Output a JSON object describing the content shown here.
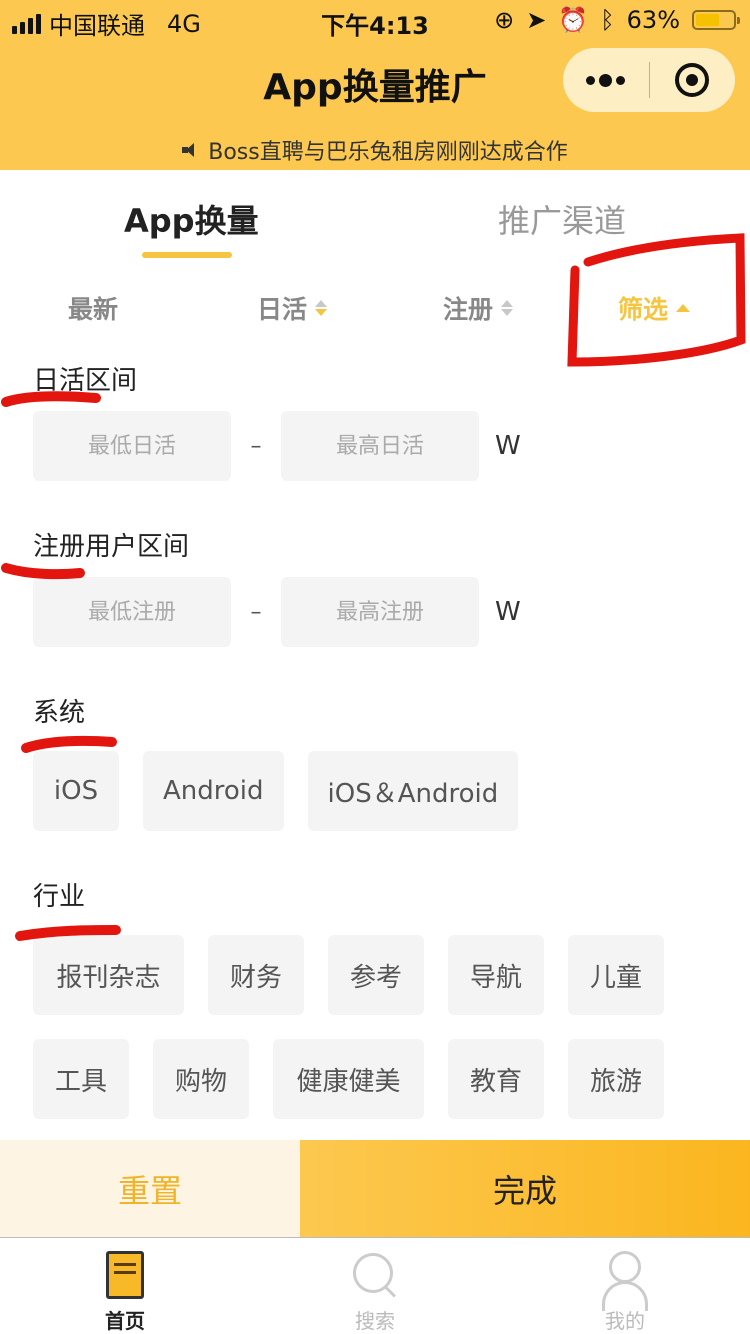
{
  "status_bar": {
    "carrier": "中国联通",
    "network": "4G",
    "time": "下午4:13",
    "battery": "63%",
    "battery_level": 0.63,
    "icons": [
      "rotation-lock-icon",
      "location-icon",
      "alarm-icon",
      "bluetooth-icon"
    ]
  },
  "header": {
    "title": "App换量推广",
    "notice": "Boss直聘与巴乐兔租房刚刚达成合作",
    "capsule": {
      "more_icon": "more-dots-icon",
      "close_icon": "target-icon"
    },
    "accent": "#fcc84f"
  },
  "tabs": [
    {
      "label": "App换量",
      "active": true
    },
    {
      "label": "推广渠道",
      "active": false
    }
  ],
  "sort_bar": {
    "items": [
      {
        "label": "最新"
      },
      {
        "label": "日活",
        "sort": "desc"
      },
      {
        "label": "注册",
        "sort": "none"
      },
      {
        "label": "筛选",
        "active": true
      }
    ]
  },
  "filters": {
    "daily_active": {
      "title": "日活区间",
      "min_placeholder": "最低日活",
      "max_placeholder": "最高日活",
      "min_value": "",
      "max_value": "",
      "separator": "–",
      "unit": "W"
    },
    "registered": {
      "title": "注册用户区间",
      "min_placeholder": "最低注册",
      "max_placeholder": "最高注册",
      "min_value": "",
      "max_value": "",
      "separator": "–",
      "unit": "W"
    },
    "system": {
      "title": "系统",
      "options": [
        "iOS",
        "Android",
        "iOS＆Android"
      ]
    },
    "industry": {
      "title": "行业",
      "options": [
        "报刊杂志",
        "财务",
        "参考",
        "导航",
        "儿童",
        "工具",
        "购物",
        "健康健美",
        "教育",
        "旅游"
      ]
    }
  },
  "actions": {
    "reset_label": "重置",
    "done_label": "完成"
  },
  "tabbar": [
    {
      "label": "首页",
      "icon": "home-icon",
      "active": true
    },
    {
      "label": "搜索",
      "icon": "search-icon",
      "active": false
    },
    {
      "label": "我的",
      "icon": "profile-icon",
      "active": false
    }
  ]
}
